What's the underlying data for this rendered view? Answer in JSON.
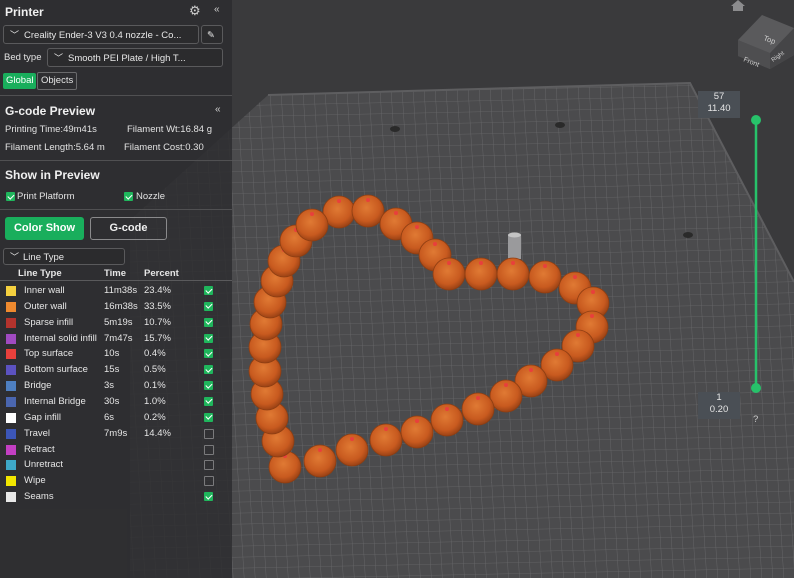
{
  "printer": {
    "title": "Printer",
    "printer_select": "Creality Ender-3 V3 0.4 nozzle - Co...",
    "bed_type_label": "Bed type",
    "bed_type_value": "Smooth PEI Plate / High T...",
    "tabs": [
      "Global",
      "Objects"
    ]
  },
  "gcode_preview": {
    "title": "G-code Preview",
    "printing_time": "Printing Time:49m41s",
    "filament_wt": "Filament Wt:16.84 g",
    "filament_length": "Filament Length:5.64 m",
    "filament_cost": "Filament Cost:0.30"
  },
  "show_in_preview": {
    "title": "Show in Preview",
    "print_platform": "Print Platform",
    "nozzle": "Nozzle"
  },
  "view_buttons": {
    "color_show": "Color Show",
    "gcode": "G-code"
  },
  "line_type_select": "Line Type",
  "table": {
    "headers": [
      "Line Type",
      "Time",
      "Percent"
    ],
    "rows": [
      {
        "name": "Inner wall",
        "time": "11m38s",
        "percent": "23.4%",
        "color": "#f4d03f",
        "checked": true
      },
      {
        "name": "Outer wall",
        "time": "16m38s",
        "percent": "33.5%",
        "color": "#ef8a2f",
        "checked": true
      },
      {
        "name": "Sparse infill",
        "time": "5m19s",
        "percent": "10.7%",
        "color": "#b4332d",
        "checked": true
      },
      {
        "name": "Internal solid infill",
        "time": "7m47s",
        "percent": "15.7%",
        "color": "#a04ac0",
        "checked": true
      },
      {
        "name": "Top surface",
        "time": "10s",
        "percent": "0.4%",
        "color": "#e8403c",
        "checked": true
      },
      {
        "name": "Bottom surface",
        "time": "15s",
        "percent": "0.5%",
        "color": "#5c52c0",
        "checked": true
      },
      {
        "name": "Bridge",
        "time": "3s",
        "percent": "0.1%",
        "color": "#4e7fc0",
        "checked": true
      },
      {
        "name": "Internal Bridge",
        "time": "30s",
        "percent": "1.0%",
        "color": "#4a66b0",
        "checked": true
      },
      {
        "name": "Gap infill",
        "time": "6s",
        "percent": "0.2%",
        "color": "#ffffff",
        "checked": true
      },
      {
        "name": "Travel",
        "time": "7m9s",
        "percent": "14.4%",
        "color": "#3c56b8",
        "checked": false
      },
      {
        "name": "Retract",
        "time": "",
        "percent": "",
        "color": "#c33fc3",
        "checked": false
      },
      {
        "name": "Unretract",
        "time": "",
        "percent": "",
        "color": "#3ea8c8",
        "checked": false
      },
      {
        "name": "Wipe",
        "time": "",
        "percent": "",
        "color": "#f2e600",
        "checked": false
      },
      {
        "name": "Seams",
        "time": "",
        "percent": "",
        "color": "#e8e8e8",
        "checked": true
      }
    ]
  },
  "layer_slider": {
    "top_layer": "57",
    "top_height": "11.40",
    "bottom_layer": "1",
    "bottom_height": "0.20",
    "help": "?"
  },
  "view_cube": {
    "top": "Top",
    "front": "Front",
    "right": "Right"
  },
  "colors": {
    "accent": "#19ae5c",
    "bead": "#c85a1f"
  }
}
